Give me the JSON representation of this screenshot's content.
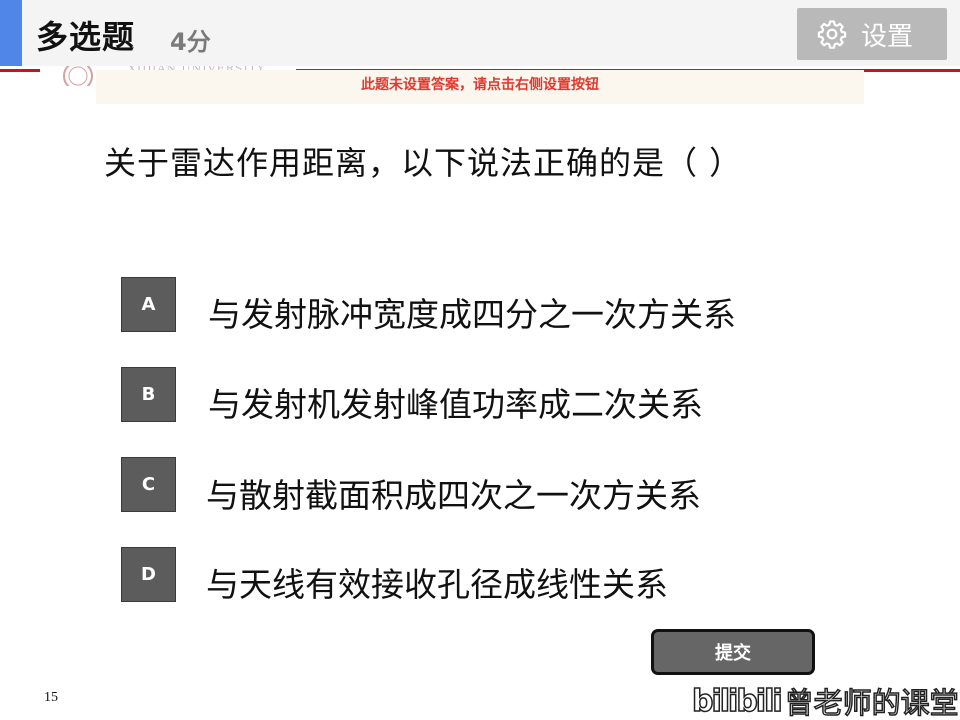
{
  "header": {
    "question_type": "多选题",
    "score": "4分",
    "settings_label": "设置"
  },
  "slide": {
    "school_name": "XIDIAN UNIVERSITY",
    "page_number": "15"
  },
  "notice": "此题未设置答案，请点击右侧设置按钮",
  "question": "关于雷达作用距离，以下说法正确的是（    ）",
  "options": [
    {
      "letter": "A",
      "text": "与发射脉冲宽度成四分之一次方关系"
    },
    {
      "letter": "B",
      "text": "与发射机发射峰值功率成二次关系"
    },
    {
      "letter": "C",
      "text": "与散射截面积成四次之一次方关系"
    },
    {
      "letter": "D",
      "text": "与天线有效接收孔径成线性关系"
    }
  ],
  "submit_label": "提交",
  "watermark": {
    "logo": "bilibili",
    "text": "曾老师的课堂"
  },
  "colors": {
    "accent_blue": "#4f86e8",
    "brand_red": "#c8141e",
    "notice_red": "#e0392f",
    "option_gray": "#5c5c5c",
    "settings_gray": "#b9b9b9"
  }
}
